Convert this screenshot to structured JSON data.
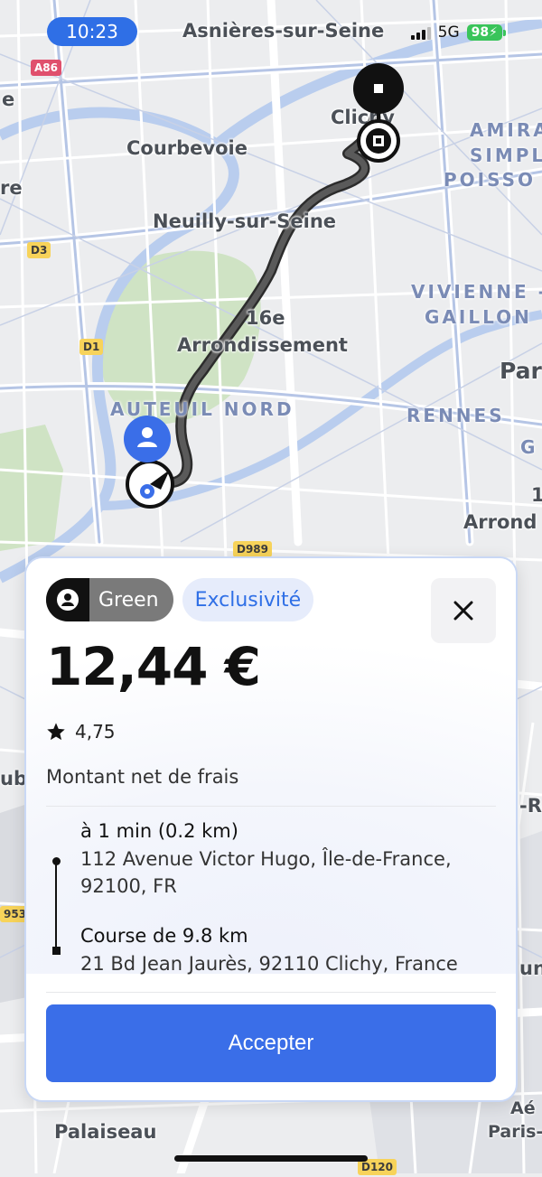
{
  "status_bar": {
    "time": "10:23",
    "network": "5G",
    "battery": "98"
  },
  "map": {
    "towns": [
      "Asnières-sur-Seine",
      "Clichy",
      "Courbevoie",
      "Neuilly-sur-Seine",
      "16e",
      "Arrondissement",
      "Palaiseau",
      "Aé",
      "Paris-",
      "Par",
      "Arrond",
      "re",
      "e",
      "-Ro",
      "un",
      "ub",
      "G",
      "1"
    ],
    "districts": [
      "AMIRA",
      "SIMPL",
      "POISSO",
      "VIVIENNE -",
      "GAILLON",
      "RENNES",
      "AUTEUIL NORD"
    ],
    "roads": [
      "A86",
      "D3",
      "D1",
      "D989",
      "D120",
      "953"
    ]
  },
  "card": {
    "product_tag": "Green",
    "exclusivity_tag": "Exclusivité",
    "price": "12,44 €",
    "rating": "4,75",
    "net_note": "Montant net de frais",
    "pickup": {
      "eta": "à 1 min (0.2 km)",
      "address_line1": "112 Avenue Victor Hugo, Île-de-France,",
      "address_line2": "92100, FR"
    },
    "dropoff": {
      "trip": "Course de 9.8 km",
      "address": "21 Bd Jean Jaurès, 92110 Clichy, France"
    },
    "accept_label": "Accepter"
  },
  "colors": {
    "accent": "#3a6ee8",
    "route": "#4a4a4a",
    "rider_pin": "#3a6ee8"
  },
  "icons": [
    "person-icon",
    "close-icon",
    "star-icon",
    "signal-icon",
    "battery-icon",
    "pickup-pin-icon",
    "dropoff-pin-icon"
  ]
}
